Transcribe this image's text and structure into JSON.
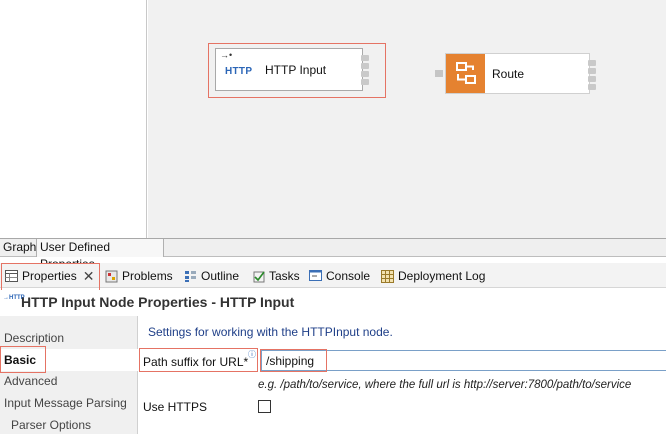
{
  "canvas": {
    "nodes": [
      {
        "label": "HTTP Input",
        "icon_text": "HTTP",
        "icon": "http-input-node-icon"
      },
      {
        "label": "Route",
        "icon": "route-node-icon",
        "color": "#e58230"
      }
    ]
  },
  "graph_tabs": [
    "Graph",
    "User Defined Properties"
  ],
  "view_tabs": [
    {
      "label": "Properties",
      "icon": "properties-icon"
    },
    {
      "label": "Problems",
      "icon": "problems-icon"
    },
    {
      "label": "Outline",
      "icon": "outline-icon"
    },
    {
      "label": "Tasks",
      "icon": "tasks-icon"
    },
    {
      "label": "Console",
      "icon": "console-icon"
    },
    {
      "label": "Deployment Log",
      "icon": "deployment-log-icon"
    }
  ],
  "properties": {
    "title": "HTTP Input Node Properties - HTTP Input",
    "categories": [
      "Description",
      "Basic",
      "Advanced",
      "Input Message Parsing",
      "Parser Options"
    ],
    "selected_category": "Basic",
    "settings_text": "Settings for working with the HTTPInput node.",
    "path_label": "Path suffix for URL*",
    "path_value": "/shipping",
    "hint": "e.g. /path/to/service, where the full url is http://server:7800/path/to/service",
    "https_label": "Use HTTPS",
    "https_checked": false
  },
  "colors": {
    "highlight": "#e57364",
    "link_text": "#1f3f88",
    "http_blue": "#2c66b7"
  }
}
